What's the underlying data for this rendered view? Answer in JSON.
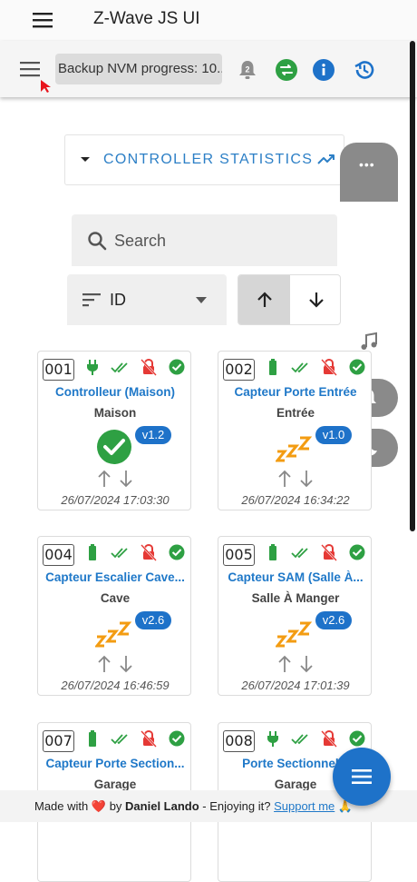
{
  "app": {
    "title": "Z-Wave JS UI"
  },
  "toolbar": {
    "progress_text": "Backup NVM progress: 10...",
    "notification_count": "2"
  },
  "stats": {
    "label": "CONTROLLER STATISTICS"
  },
  "search": {
    "placeholder": "Search"
  },
  "sort": {
    "value": "ID"
  },
  "nodes": [
    {
      "id": "001",
      "name": "Controlleur (Maison)",
      "location": "Maison",
      "version": "v1.2",
      "status": "ready",
      "power": "plug",
      "time": "26/07/2024 17:03:30"
    },
    {
      "id": "002",
      "name": "Capteur Porte Entrée",
      "location": "Entrée",
      "version": "v1.0",
      "status": "asleep",
      "power": "battery",
      "time": "26/07/2024 16:34:22"
    },
    {
      "id": "004",
      "name": "Capteur Escalier Cave...",
      "location": "Cave",
      "version": "v2.6",
      "status": "asleep",
      "power": "battery",
      "time": "26/07/2024 16:46:59"
    },
    {
      "id": "005",
      "name": "Capteur SAM (Salle À...",
      "location": "Salle À Manger",
      "version": "v2.6",
      "status": "asleep",
      "power": "battery",
      "time": "26/07/2024 17:01:39"
    },
    {
      "id": "007",
      "name": "Capteur Porte Section...",
      "location": "Garage",
      "version": "",
      "status": "",
      "power": "battery",
      "time": ""
    },
    {
      "id": "008",
      "name": "Porte Sectionnelle",
      "location": "Garage",
      "version": "",
      "status": "",
      "power": "plug",
      "time": ""
    }
  ],
  "footer": {
    "made_with": "Made with",
    "heart": "❤️",
    "by": "by",
    "author": "Daniel Lando",
    "enjoy": "- Enjoying it?",
    "support": "Support me",
    "emoji": "🙏"
  },
  "colors": {
    "accent": "#1e72c9",
    "green": "#2ea043",
    "red": "#e53935",
    "orange": "#f39c12"
  }
}
